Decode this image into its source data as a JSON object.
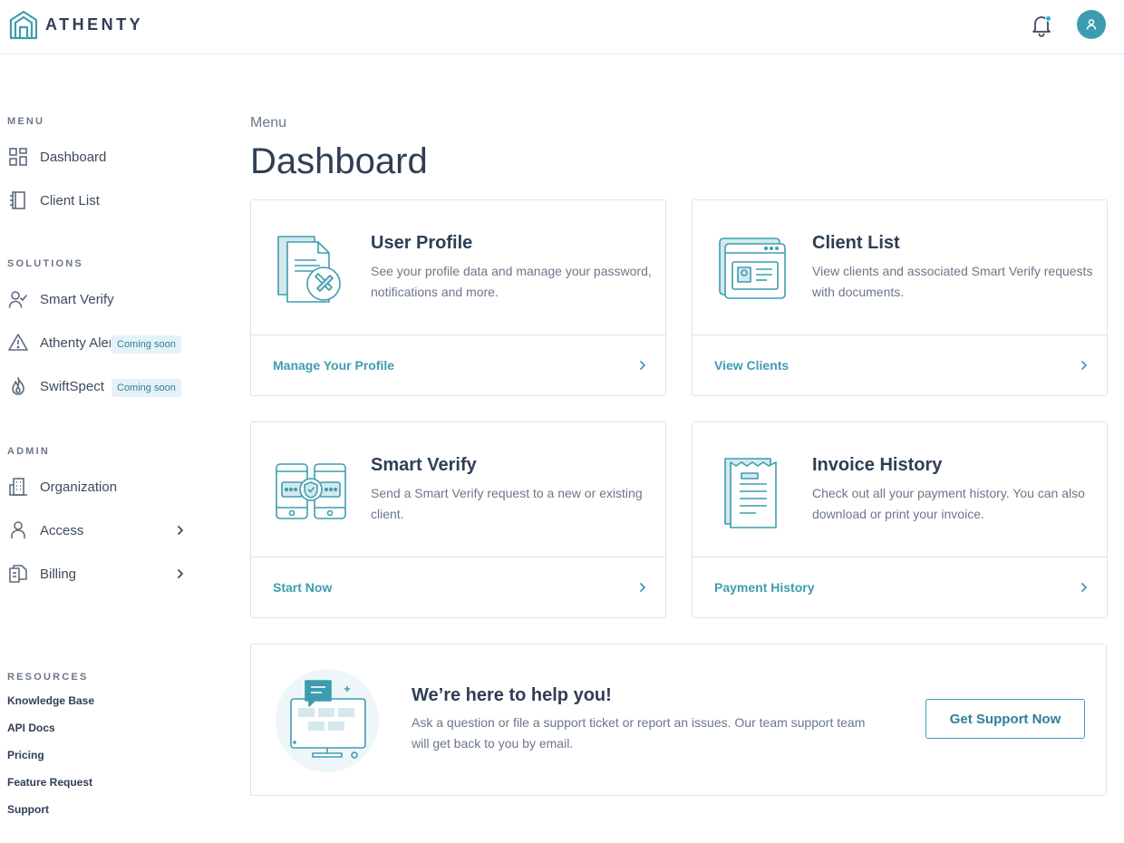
{
  "app": {
    "brand": "ATHENTY"
  },
  "header": {
    "notification_icon": "bell-icon",
    "avatar_icon": "user-icon"
  },
  "sidebar": {
    "sections": {
      "menu": "MENU",
      "solutions": "SOLUTIONS",
      "admin": "ADMIN",
      "resources": "RESOURCES"
    },
    "menu_items": [
      {
        "label": "Dashboard",
        "icon": "grid-icon"
      },
      {
        "label": "Client List",
        "icon": "notebook-icon"
      }
    ],
    "solution_items": [
      {
        "label": "Smart Verify",
        "icon": "user-check-icon"
      },
      {
        "label": "Athenty Alert",
        "icon": "alert-triangle-icon",
        "badge": "Coming soon"
      },
      {
        "label": "SwiftSpect",
        "icon": "flame-icon",
        "badge": "Coming soon"
      }
    ],
    "admin_items": [
      {
        "label": "Organization",
        "icon": "building-icon"
      },
      {
        "label": "Access",
        "icon": "person-icon"
      },
      {
        "label": "Billing",
        "icon": "documents-icon"
      }
    ],
    "resources": [
      "Knowledge Base",
      "API Docs",
      "Pricing",
      "Feature Request",
      "Support"
    ]
  },
  "main": {
    "breadcrumb": "Menu",
    "title": "Dashboard",
    "cards": [
      {
        "title": "User Profile",
        "description": "See your profile data and manage your password, notifications and more.",
        "link": "Manage Your Profile",
        "icon": "profile-document-icon"
      },
      {
        "title": "Client List",
        "description": "View clients and associated Smart Verify requests with documents.",
        "link": "View Clients",
        "icon": "id-card-window-icon"
      },
      {
        "title": "Smart Verify",
        "description": "Send a Smart Verify request to a new or existing client.",
        "link": "Start Now",
        "icon": "phones-shield-icon"
      },
      {
        "title": "Invoice History",
        "description": "Check out all your payment history. You can also download or print your invoice.",
        "link": "Payment History",
        "icon": "receipt-icon"
      }
    ],
    "help": {
      "title": "We’re here to help you!",
      "description": "Ask a question or file a support ticket or report an issues. Our team support team will get back to you by email.",
      "button": "Get Support Now",
      "icon": "monitor-chat-icon"
    }
  },
  "colors": {
    "accent": "#3d9db0",
    "text": "#2f3e55",
    "muted": "#6b7789",
    "badge_bg": "#e5f2f7",
    "notification_dot": "#1fb7c9"
  }
}
